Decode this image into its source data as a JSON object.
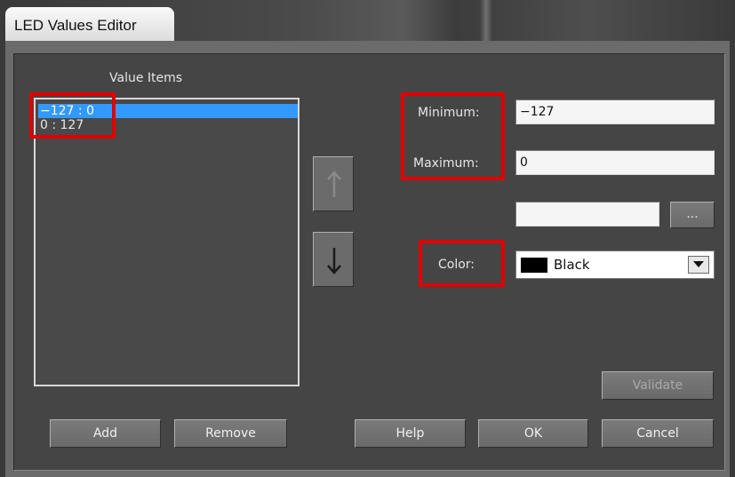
{
  "window": {
    "title": "LED Values Editor"
  },
  "list": {
    "header": "Value Items",
    "items": [
      {
        "label": "−127 : 0",
        "selected": true
      },
      {
        "label": "0 : 127",
        "selected": false
      }
    ]
  },
  "fields": {
    "minimum_label": "Minimum:",
    "minimum_value": "−127",
    "maximum_label": "Maximum:",
    "maximum_value": "0",
    "extra_value": "",
    "browse_label": "...",
    "color_label": "Color:",
    "color_value": "Black",
    "color_swatch": "#000000"
  },
  "buttons": {
    "move_up_icon": "up-arrow-icon",
    "move_down_icon": "down-arrow-icon",
    "validate": "Validate",
    "add": "Add",
    "remove": "Remove",
    "help": "Help",
    "ok": "OK",
    "cancel": "Cancel"
  },
  "colors": {
    "selection": "#3399ff",
    "annotation": "#e00000"
  }
}
